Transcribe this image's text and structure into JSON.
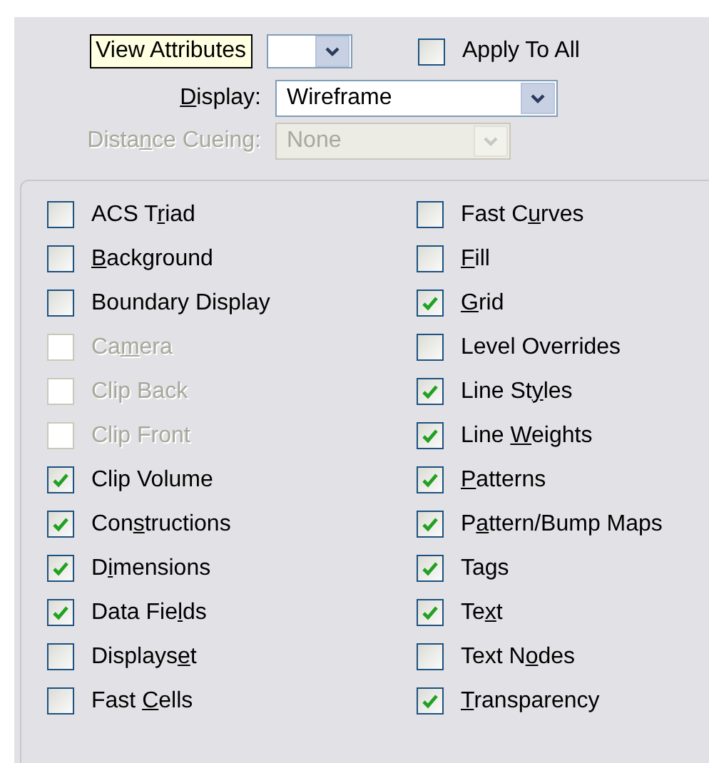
{
  "view_selector": {
    "tooltip": "View Attributes"
  },
  "apply_to_all": {
    "label": "Apply To All",
    "checked": false
  },
  "display": {
    "label": {
      "key": "D",
      "post": "isplay:"
    },
    "value": "Wireframe",
    "disabled": false
  },
  "distance_cueing": {
    "label": {
      "pre": "Dista",
      "key": "n",
      "post": "ce Cueing:"
    },
    "value": "None",
    "disabled": true
  },
  "attributes_left": [
    {
      "label": {
        "pre": "ACS T",
        "key": "r",
        "post": "iad"
      },
      "checked": false,
      "disabled": false
    },
    {
      "label": {
        "key": "B",
        "post": "ackground"
      },
      "checked": false,
      "disabled": false
    },
    {
      "label": {
        "pre": "Boundary Display"
      },
      "checked": false,
      "disabled": false
    },
    {
      "label": {
        "pre": "Ca",
        "key": "m",
        "post": "era"
      },
      "checked": false,
      "disabled": true
    },
    {
      "label": {
        "pre": "Clip Back"
      },
      "checked": false,
      "disabled": true
    },
    {
      "label": {
        "pre": "Clip Front"
      },
      "checked": false,
      "disabled": true
    },
    {
      "label": {
        "pre": "Clip Volume"
      },
      "checked": true,
      "disabled": false
    },
    {
      "label": {
        "pre": "Con",
        "key": "s",
        "post": "tructions"
      },
      "checked": true,
      "disabled": false
    },
    {
      "label": {
        "pre": "D",
        "key": "i",
        "post": "mensions"
      },
      "checked": true,
      "disabled": false
    },
    {
      "label": {
        "pre": "Data Fie",
        "key": "l",
        "post": "ds"
      },
      "checked": true,
      "disabled": false
    },
    {
      "label": {
        "pre": "Displays",
        "key": "e",
        "post": "t"
      },
      "checked": false,
      "disabled": false
    },
    {
      "label": {
        "pre": "Fast ",
        "key": "C",
        "post": "ells"
      },
      "checked": false,
      "disabled": false
    }
  ],
  "attributes_right": [
    {
      "label": {
        "pre": "Fast C",
        "key": "u",
        "post": "rves"
      },
      "checked": false,
      "disabled": false
    },
    {
      "label": {
        "key": "F",
        "post": "ill"
      },
      "checked": false,
      "disabled": false
    },
    {
      "label": {
        "key": "G",
        "post": "rid"
      },
      "checked": true,
      "disabled": false
    },
    {
      "label": {
        "pre": "Level Overrides"
      },
      "checked": false,
      "disabled": false
    },
    {
      "label": {
        "pre": "Line St",
        "key": "y",
        "post": "les"
      },
      "checked": true,
      "disabled": false
    },
    {
      "label": {
        "pre": "Line ",
        "key": "W",
        "post": "eights"
      },
      "checked": true,
      "disabled": false
    },
    {
      "label": {
        "key": "P",
        "post": "atterns"
      },
      "checked": true,
      "disabled": false
    },
    {
      "label": {
        "pre": "P",
        "key": "a",
        "post": "ttern/Bump Maps"
      },
      "checked": true,
      "disabled": false
    },
    {
      "label": {
        "pre": "Tags"
      },
      "checked": true,
      "disabled": false
    },
    {
      "label": {
        "pre": "Te",
        "key": "x",
        "post": "t"
      },
      "checked": true,
      "disabled": false
    },
    {
      "label": {
        "pre": "Text N",
        "key": "o",
        "post": "des"
      },
      "checked": false,
      "disabled": false
    },
    {
      "label": {
        "key": "T",
        "post": "ransparency"
      },
      "checked": true,
      "disabled": false
    }
  ]
}
